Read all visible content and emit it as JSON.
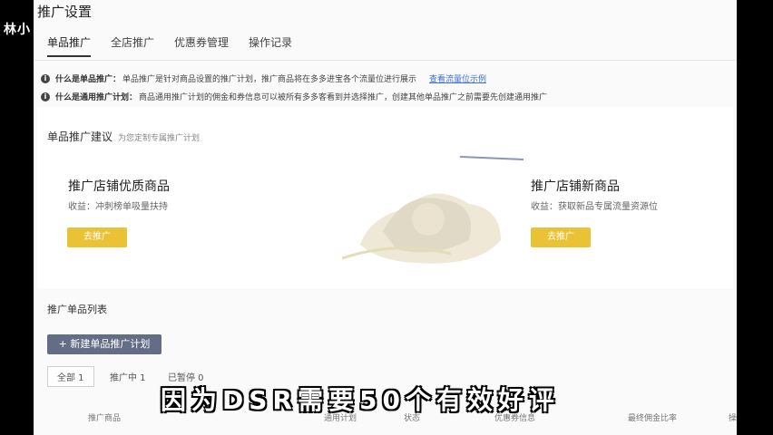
{
  "side_label": "林小",
  "page_title": "推广设置",
  "tabs": [
    {
      "label": "单品推广"
    },
    {
      "label": "全店推广"
    },
    {
      "label": "优惠券管理"
    },
    {
      "label": "操作记录"
    }
  ],
  "notices": [
    {
      "q": "什么是单品推广：",
      "text": "单品推广是针对商品设置的推广计划，推广商品将在多多进宝各个流量位进行展示",
      "link": "查看流量位示例"
    },
    {
      "q": "什么是通用推广计划：",
      "text": "商品通用推广计划的佣金和券信息可以被所有多多客看到并选择推广，创建其他单品推广之前需要先创建通用推广",
      "link": ""
    }
  ],
  "suggest": {
    "title": "单品推广建议",
    "subtitle": "为您定制专属推广计划"
  },
  "card_left": {
    "title": "推广店铺优质商品",
    "sub": "收益：冲刺榜单吸量扶持",
    "button": "去推广"
  },
  "card_right": {
    "title": "推广店铺新商品",
    "sub": "收益：获取新品专属流量资源位",
    "button": "去推广"
  },
  "list": {
    "title": "推广单品列表",
    "new_button": "+ 新建单品推广计划",
    "filters": [
      "全部 1",
      "推广中 1",
      "已暂停 0"
    ],
    "columns": [
      "推广商品",
      "通用计划",
      "状态",
      "优惠券信息",
      "最终佣金比率",
      "操"
    ]
  },
  "subtitle": "因为DSR需要50个有效好评"
}
